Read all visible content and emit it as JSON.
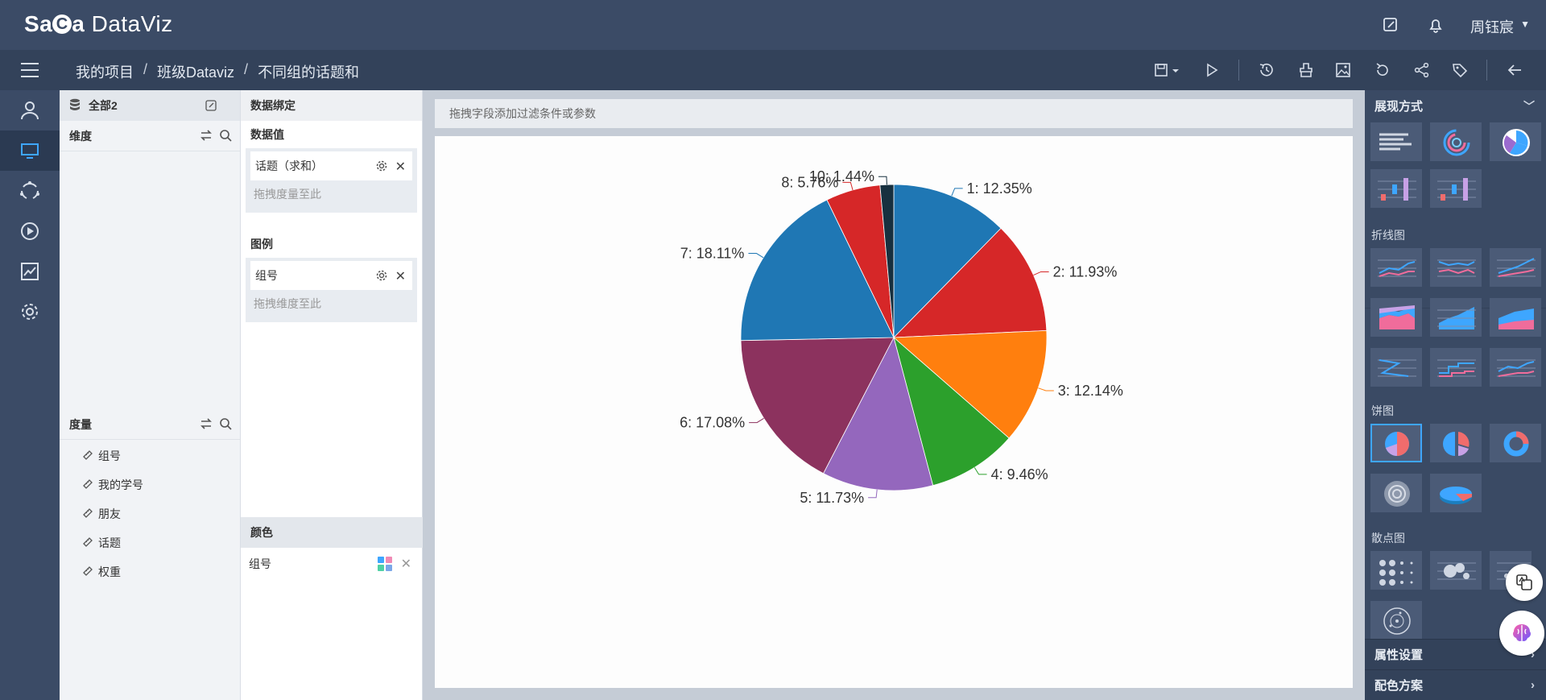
{
  "header": {
    "logo_sa": "Sa",
    "logo_c": "C",
    "logo_a": "a",
    "logo_dataviz": " DataViz",
    "user_name": "周钰宸"
  },
  "breadcrumb": [
    "我的项目",
    "班级Dataviz",
    "不同组的话题和"
  ],
  "fields": {
    "dataset": "全部2",
    "dimension_title": "维度",
    "measure_title": "度量",
    "measures": [
      "组号",
      "我的学号",
      "朋友",
      "话题",
      "权重"
    ]
  },
  "binding": {
    "title": "数据绑定",
    "values_title": "数据值",
    "value_chip": "话题（求和）",
    "value_hint": "拖拽度量至此",
    "legend_title": "图例",
    "legend_chip": "组号",
    "legend_hint": "拖拽维度至此",
    "color_title": "颜色",
    "color_field": "组号"
  },
  "filter_hint": "拖拽字段添加过滤条件或参数",
  "right_panel": {
    "display_title": "展现方式",
    "line_title": "折线图",
    "pie_title": "饼图",
    "scatter_title": "散点图",
    "attr_title": "属性设置",
    "palette_title": "配色方案"
  },
  "colors": {
    "accent": "#3ea6ff",
    "header_bg": "#3b4b66"
  },
  "chart_data": {
    "type": "pie",
    "title": "",
    "categories": [
      "1",
      "2",
      "3",
      "4",
      "5",
      "6",
      "7",
      "8",
      "10"
    ],
    "values": [
      12.35,
      11.93,
      12.14,
      9.46,
      11.73,
      17.08,
      18.11,
      5.76,
      1.44
    ],
    "labels": [
      "1: 12.35%",
      "2: 11.93%",
      "3: 12.14%",
      "4: 9.46%",
      "5: 11.73%",
      "6: 17.08%",
      "7: 18.11%",
      "8: 5.76%",
      "10: 1.44%"
    ],
    "colors": [
      "#1f77b4",
      "#d62728",
      "#ff7f0e",
      "#2ca02c",
      "#9467bd",
      "#8c325e",
      "#1f77b4",
      "#d62728",
      "#17303f"
    ],
    "legend": "none"
  }
}
